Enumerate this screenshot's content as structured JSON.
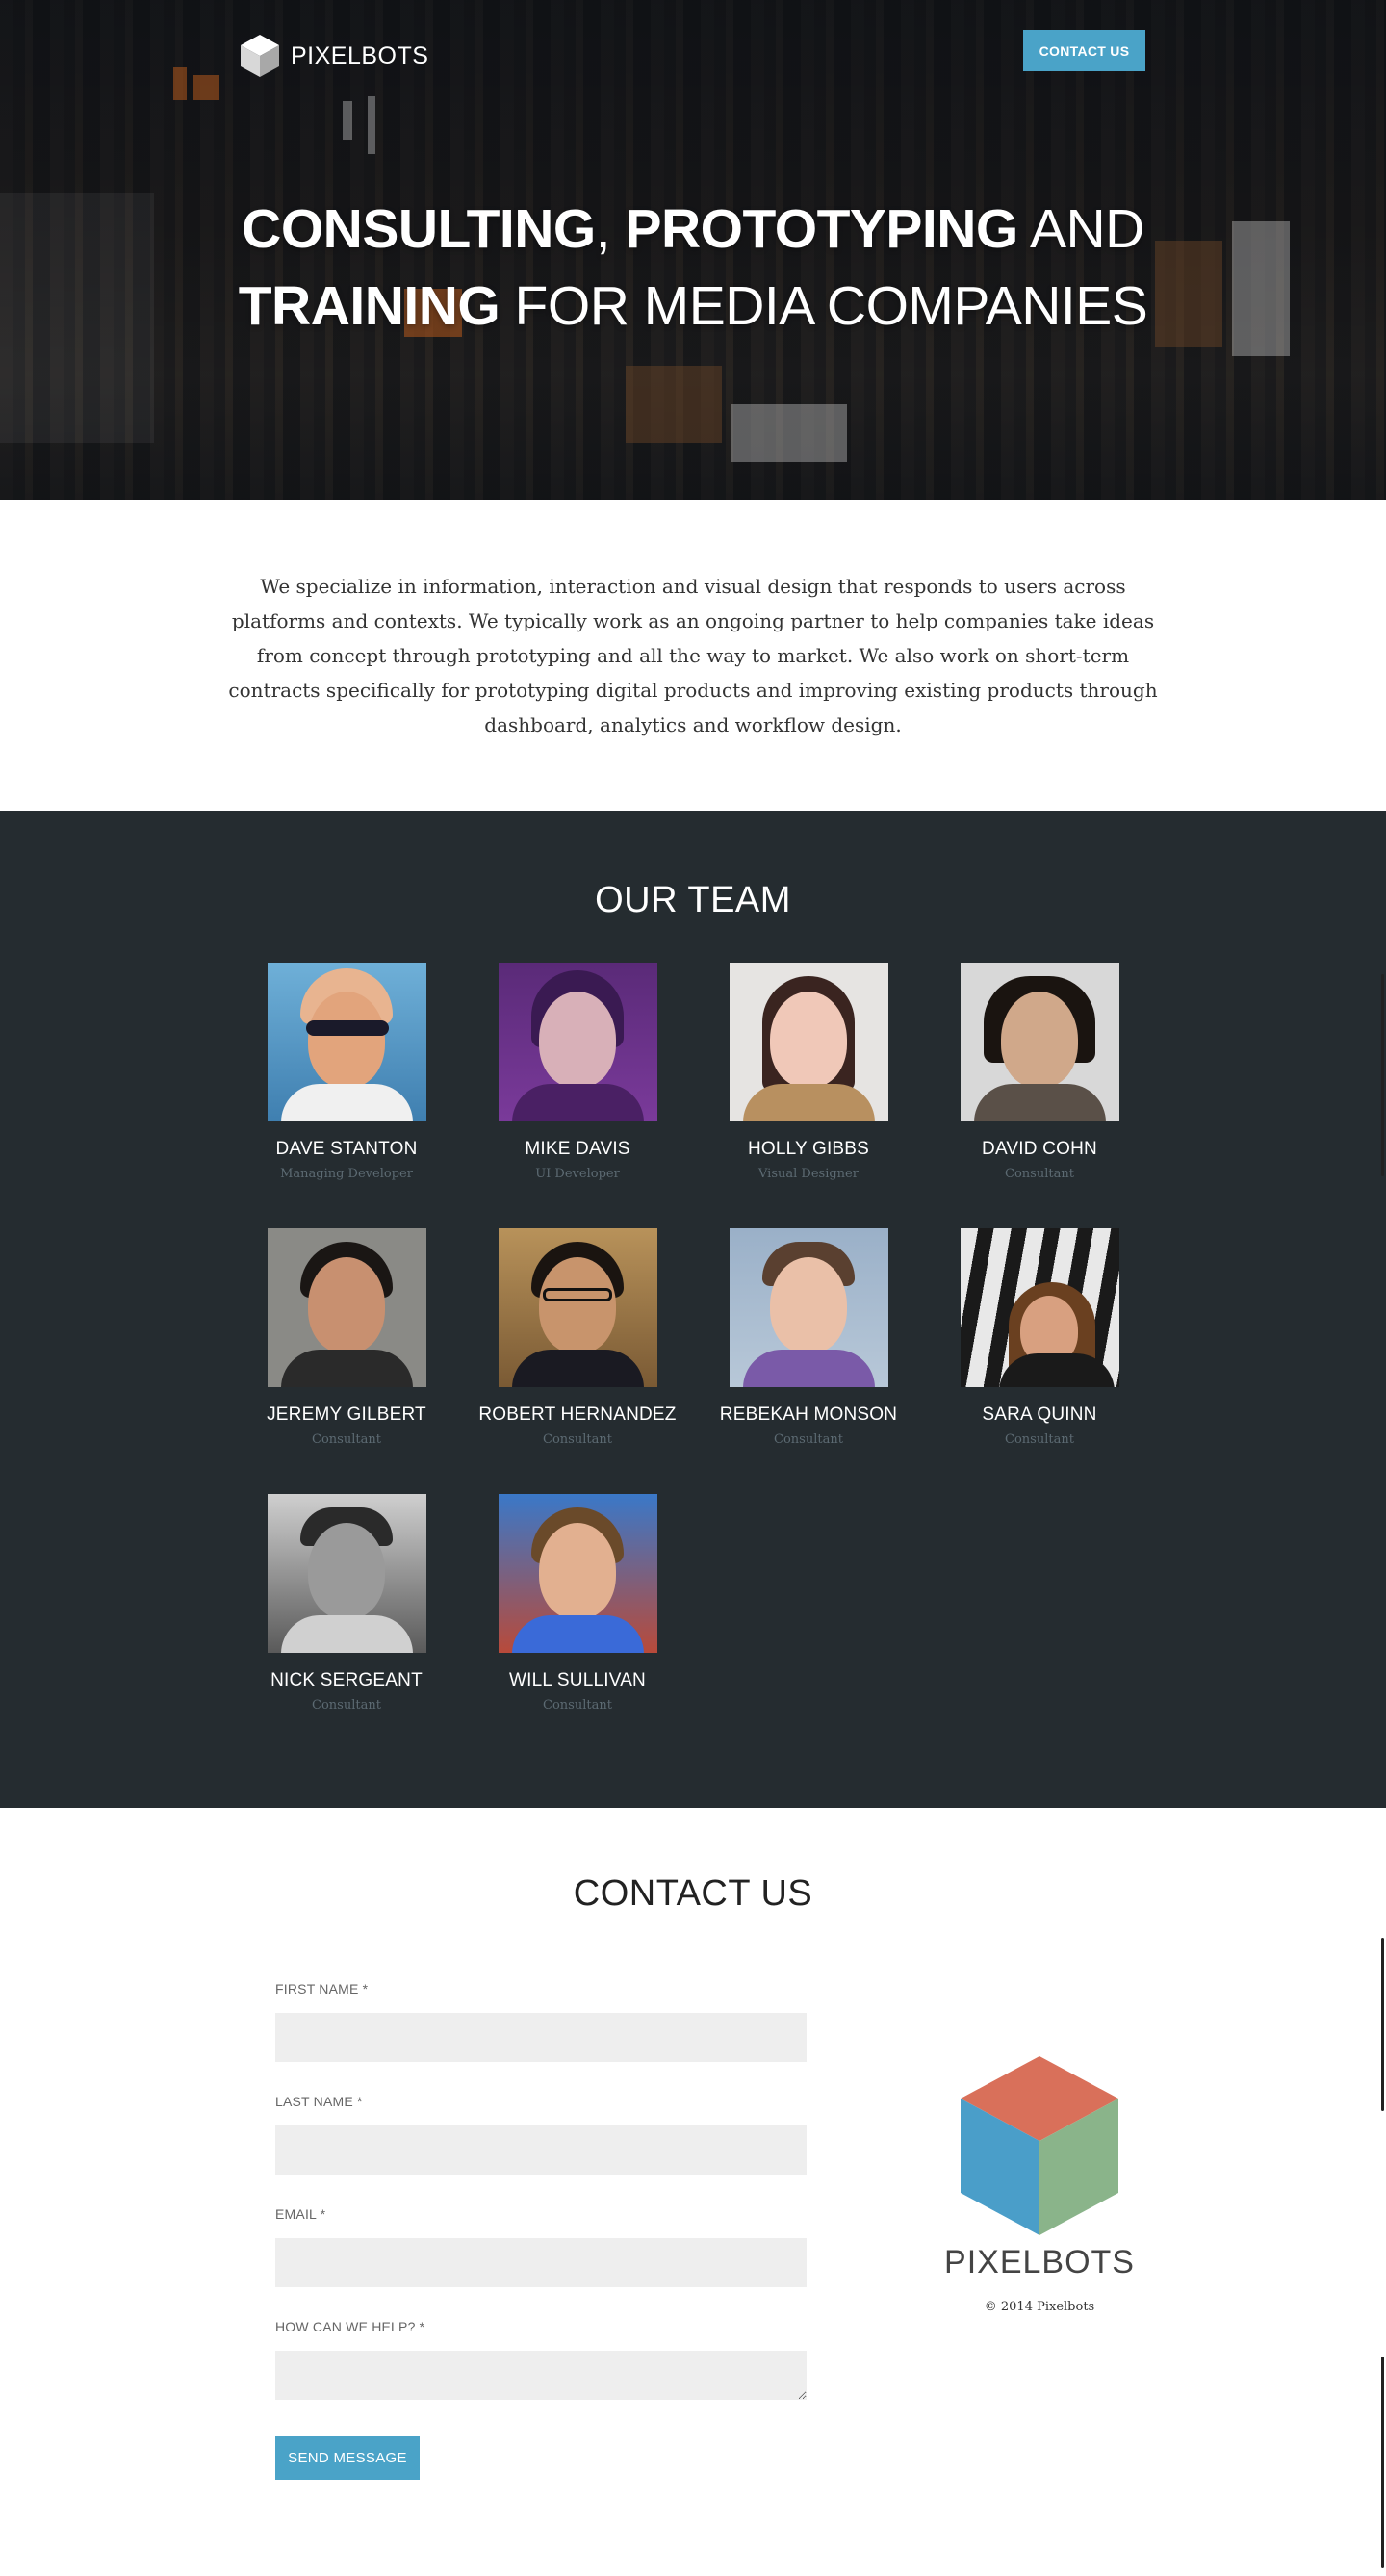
{
  "header": {
    "brand": "PIXELBOTS",
    "contact_button": "CONTACT US",
    "hero": {
      "l1_bold_1": "CONSULTING",
      "l1_sep": ", ",
      "l1_bold_2": "PROTOTYPING",
      "l1_light": " AND",
      "l2_bold": "TRAINING",
      "l2_light": " FOR MEDIA COMPANIES"
    }
  },
  "intro": {
    "text": "We specialize in information, interaction and visual design that responds to users across platforms and contexts.  We typically work as an ongoing partner to help companies take ideas from concept through prototyping and all the way to market.  We also work on short-term contracts specifically for prototyping digital products and improving existing products through dashboard, analytics and workflow design."
  },
  "team": {
    "title": "OUR TEAM",
    "members": [
      {
        "name": "DAVE STANTON",
        "role": "Managing Developer"
      },
      {
        "name": "MIKE DAVIS",
        "role": "UI Developer"
      },
      {
        "name": "HOLLY GIBBS",
        "role": "Visual Designer"
      },
      {
        "name": "DAVID COHN",
        "role": "Consultant"
      },
      {
        "name": "JEREMY GILBERT",
        "role": "Consultant"
      },
      {
        "name": "ROBERT HERNANDEZ",
        "role": "Consultant"
      },
      {
        "name": "REBEKAH MONSON",
        "role": "Consultant"
      },
      {
        "name": "SARA QUINN",
        "role": "Consultant"
      },
      {
        "name": "NICK SERGEANT",
        "role": "Consultant"
      },
      {
        "name": "WILL SULLIVAN",
        "role": "Consultant"
      }
    ]
  },
  "contact": {
    "title": "CONTACT US",
    "first_name_label": "FIRST NAME *",
    "last_name_label": "LAST NAME *",
    "email_label": "EMAIL *",
    "help_label": "HOW CAN WE HELP? *",
    "send_button": "SEND MESSAGE",
    "brand": "PIXELBOTS",
    "copyright": "© 2014 Pixelbots"
  },
  "colors": {
    "accent": "#4aa3c8",
    "team_bg": "#252c30",
    "cube_top": "#d9705a",
    "cube_left": "#4a9ec9",
    "cube_right": "#8ab48a"
  }
}
